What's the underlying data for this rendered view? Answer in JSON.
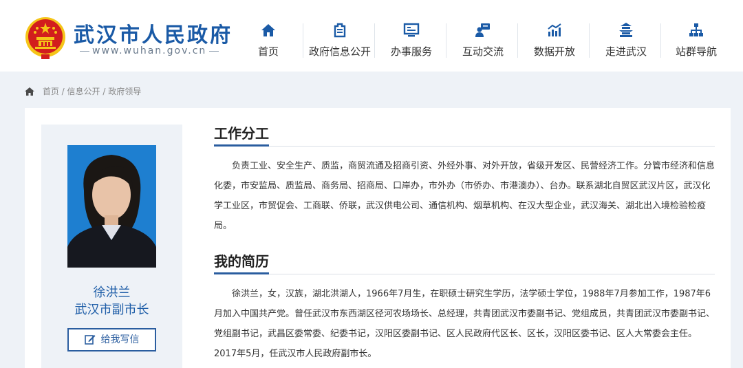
{
  "site": {
    "title": "武汉市人民政府",
    "url": "www.wuhan.gov.cn"
  },
  "nav": [
    {
      "label": "首页",
      "icon": "home-icon"
    },
    {
      "label": "政府信息公开",
      "icon": "document-icon"
    },
    {
      "label": "办事服务",
      "icon": "monitor-icon"
    },
    {
      "label": "互动交流",
      "icon": "chat-icon"
    },
    {
      "label": "数据开放",
      "icon": "bar-chart-icon"
    },
    {
      "label": "走进武汉",
      "icon": "pavilion-icon"
    },
    {
      "label": "站群导航",
      "icon": "sitemap-icon"
    }
  ],
  "breadcrumb": {
    "home": "首页",
    "section": "信息公开",
    "current": "政府领导",
    "separator": " / "
  },
  "profile": {
    "name": "徐洪兰",
    "title": "武汉市副市长",
    "button_label": "给我写信"
  },
  "duties": {
    "heading": "工作分工",
    "text": "负责工业、安全生产、质监，商贸流通及招商引资、外经外事、对外开放，省级开发区、民营经济工作。分管市经济和信息化委，市安监局、质监局、商务局、招商局、口岸办，市外办（市侨办、市港澳办）、台办。联系湖北自贸区武汉片区，武汉化学工业区，市贸促会、工商联、侨联，武汉供电公司、通信机构、烟草机构、在汉大型企业，武汉海关、湖北出入境检验检疫局。"
  },
  "resume": {
    "heading": "我的简历",
    "text": "徐洪兰，女，汉族，湖北洪湖人，1966年7月生，在职硕士研究生学历，法学硕士学位，1988年7月参加工作，1987年6月加入中国共产党。曾任武汉市东西湖区径河农场场长、总经理，共青团武汉市委副书记、党组成员，共青团武汉市委副书记、党组副书记，武昌区委常委、纪委书记，汉阳区委副书记、区人民政府代区长、区长，汉阳区委书记、区人大常委会主任。2017年5月，任武汉市人民政府副市长。"
  },
  "colors": {
    "brand": "#1a5aa6",
    "accent": "#2a5d9f",
    "emblem_red": "#d21d1d",
    "emblem_gold": "#f5c518",
    "page_bg": "#eef2f7"
  }
}
